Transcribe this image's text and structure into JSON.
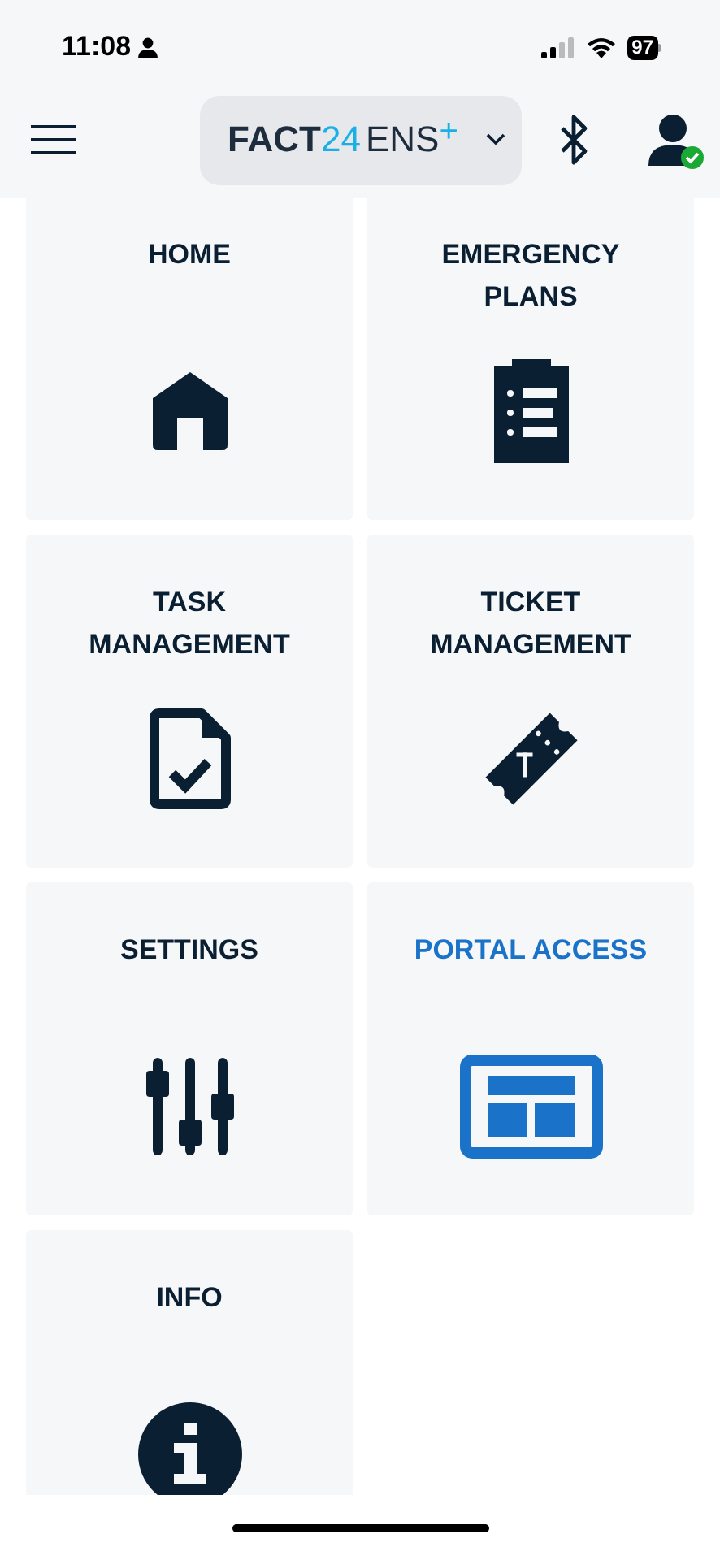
{
  "status_bar": {
    "time": "11:08",
    "battery": "97"
  },
  "header": {
    "logo": {
      "brand": "FACT",
      "number": "24",
      "product": "ENS",
      "plus": "+"
    },
    "user_online": true
  },
  "tiles": [
    {
      "label": "HOME",
      "selected": false
    },
    {
      "label": "EMERGENCY PLANS",
      "selected": false
    },
    {
      "label": "TASK MANAGEMENT",
      "selected": false
    },
    {
      "label": "TICKET MANAGEMENT",
      "selected": false
    },
    {
      "label": "SETTINGS",
      "selected": false
    },
    {
      "label": "PORTAL ACCESS",
      "selected": true
    },
    {
      "label": "INFO",
      "selected": false
    }
  ]
}
